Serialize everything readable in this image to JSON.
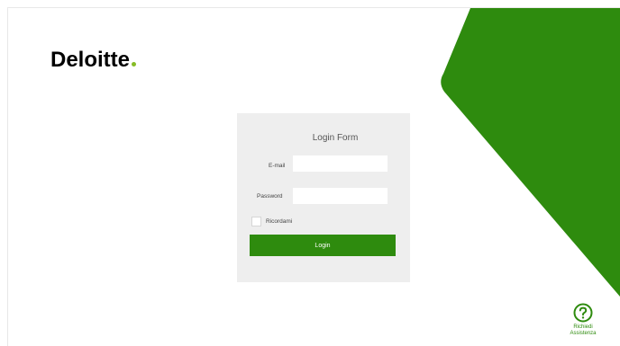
{
  "brand": {
    "name": "Deloitte",
    "accent_color": "#2e8b0e",
    "dot_color": "#86bc25"
  },
  "login_form": {
    "title": "Login Form",
    "email_label": "E-mail",
    "email_value": "",
    "password_label": "Password",
    "password_value": "",
    "remember_label": "Ricordami",
    "remember_checked": false,
    "login_button_label": "Login"
  },
  "help": {
    "icon": "question-circle-icon",
    "line1": "Richiedi",
    "line2": "Assistenza"
  }
}
